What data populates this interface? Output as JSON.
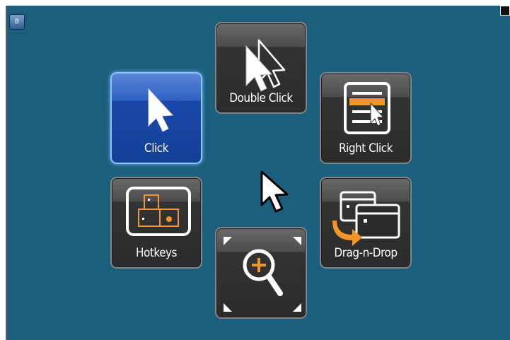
{
  "tiles": {
    "click": {
      "label": "Click",
      "icon": "arrow-cursor-icon"
    },
    "double_click": {
      "label": "Double Click",
      "icon": "double-cursor-icon"
    },
    "right_click": {
      "label": "Right Click",
      "icon": "context-menu-icon"
    },
    "hotkeys": {
      "label": "Hotkeys",
      "icon": "keyboard-keys-icon"
    },
    "drag_n_drop": {
      "label": "Drag-n-Drop",
      "icon": "drag-windows-icon"
    },
    "zoom": {
      "icon": "magnify-plus-icon"
    }
  },
  "corner_button": {
    "label": "B"
  },
  "colors": {
    "background": "#1b5f7c",
    "active": "#1a48aa",
    "accent": "#f0962b"
  }
}
